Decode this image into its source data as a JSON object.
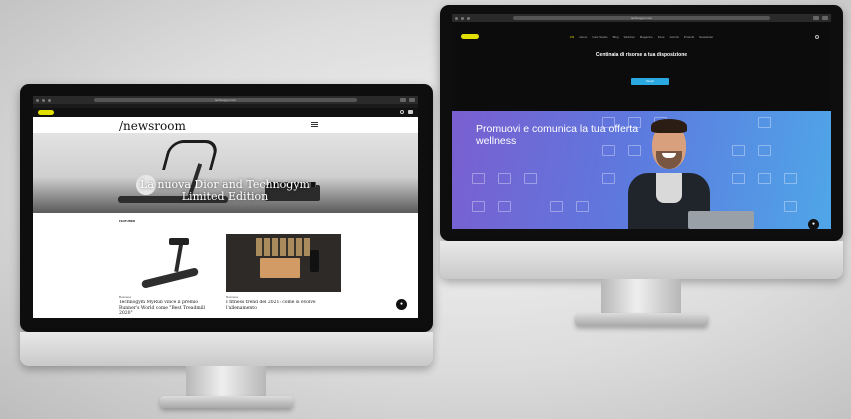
{
  "left_site": {
    "url": "technogym.com",
    "logo": "TECHNOGYM",
    "top_links": "",
    "header": {
      "title": "/newsroom"
    },
    "hero": {
      "caption": "",
      "title": "La nuova Dior and Technogym Limited Edition"
    },
    "section_label": "FEATURED",
    "cards": [
      {
        "kicker": "Business",
        "title": "Technogym MyRun vince il premio Runner's World come \"Best Treadmill 2020\""
      },
      {
        "kicker": "Business",
        "title": "I fitness trend del 2021: come si evolve l'allenamento"
      }
    ],
    "chat_icon": "chat-icon"
  },
  "right_site": {
    "url": "technogym.com",
    "logo": "TECHNOGYM",
    "nav_items": [
      "Chi",
      "siamo",
      "Casi Studio",
      "Blog",
      "Webinar",
      "Magazine",
      "Fiere",
      "Iscriviti",
      "Prodotti",
      "Newsletter"
    ],
    "heading": "Centinaia di risorse a tua disposizione",
    "subtext": "",
    "cta_label": "Scopri",
    "hero": {
      "title": "Promuovi e comunica la tua offerta wellness",
      "subtitle": ""
    },
    "chat_icon": "chat-icon"
  },
  "colors": {
    "brand_yellow": "#e2e000",
    "cta_blue": "#2aa8e0",
    "hero_gradient_start": "#7a5fd0",
    "hero_gradient_end": "#4fa6e8"
  }
}
